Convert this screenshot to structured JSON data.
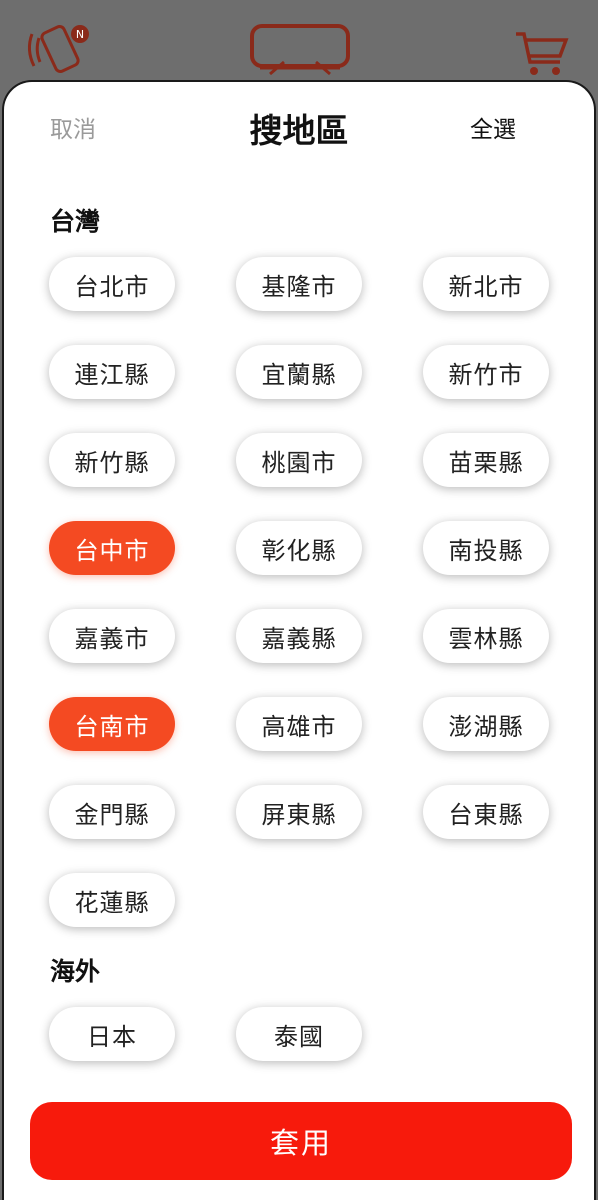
{
  "header": {
    "cancel_label": "取消",
    "title": "搜地區",
    "select_all_label": "全選"
  },
  "sections": [
    {
      "title": "台灣",
      "items": [
        {
          "label": "台北市",
          "selected": false
        },
        {
          "label": "基隆市",
          "selected": false
        },
        {
          "label": "新北市",
          "selected": false
        },
        {
          "label": "連江縣",
          "selected": false
        },
        {
          "label": "宜蘭縣",
          "selected": false
        },
        {
          "label": "新竹市",
          "selected": false
        },
        {
          "label": "新竹縣",
          "selected": false
        },
        {
          "label": "桃園市",
          "selected": false
        },
        {
          "label": "苗栗縣",
          "selected": false
        },
        {
          "label": "台中市",
          "selected": true
        },
        {
          "label": "彰化縣",
          "selected": false
        },
        {
          "label": "南投縣",
          "selected": false
        },
        {
          "label": "嘉義市",
          "selected": false
        },
        {
          "label": "嘉義縣",
          "selected": false
        },
        {
          "label": "雲林縣",
          "selected": false
        },
        {
          "label": "台南市",
          "selected": true
        },
        {
          "label": "高雄市",
          "selected": false
        },
        {
          "label": "澎湖縣",
          "selected": false
        },
        {
          "label": "金門縣",
          "selected": false
        },
        {
          "label": "屏東縣",
          "selected": false
        },
        {
          "label": "台東縣",
          "selected": false
        },
        {
          "label": "花蓮縣",
          "selected": false
        }
      ]
    },
    {
      "title": "海外",
      "items": [
        {
          "label": "日本",
          "selected": false
        },
        {
          "label": "泰國",
          "selected": false
        }
      ]
    }
  ],
  "apply_label": "套用",
  "icons": {
    "phone": "phone-notification-icon",
    "logo": "brand-logo",
    "cart": "cart-icon"
  },
  "colors": {
    "accent": "#f44a22",
    "apply": "#f71a0c",
    "overlay": "#6e6e6e"
  }
}
